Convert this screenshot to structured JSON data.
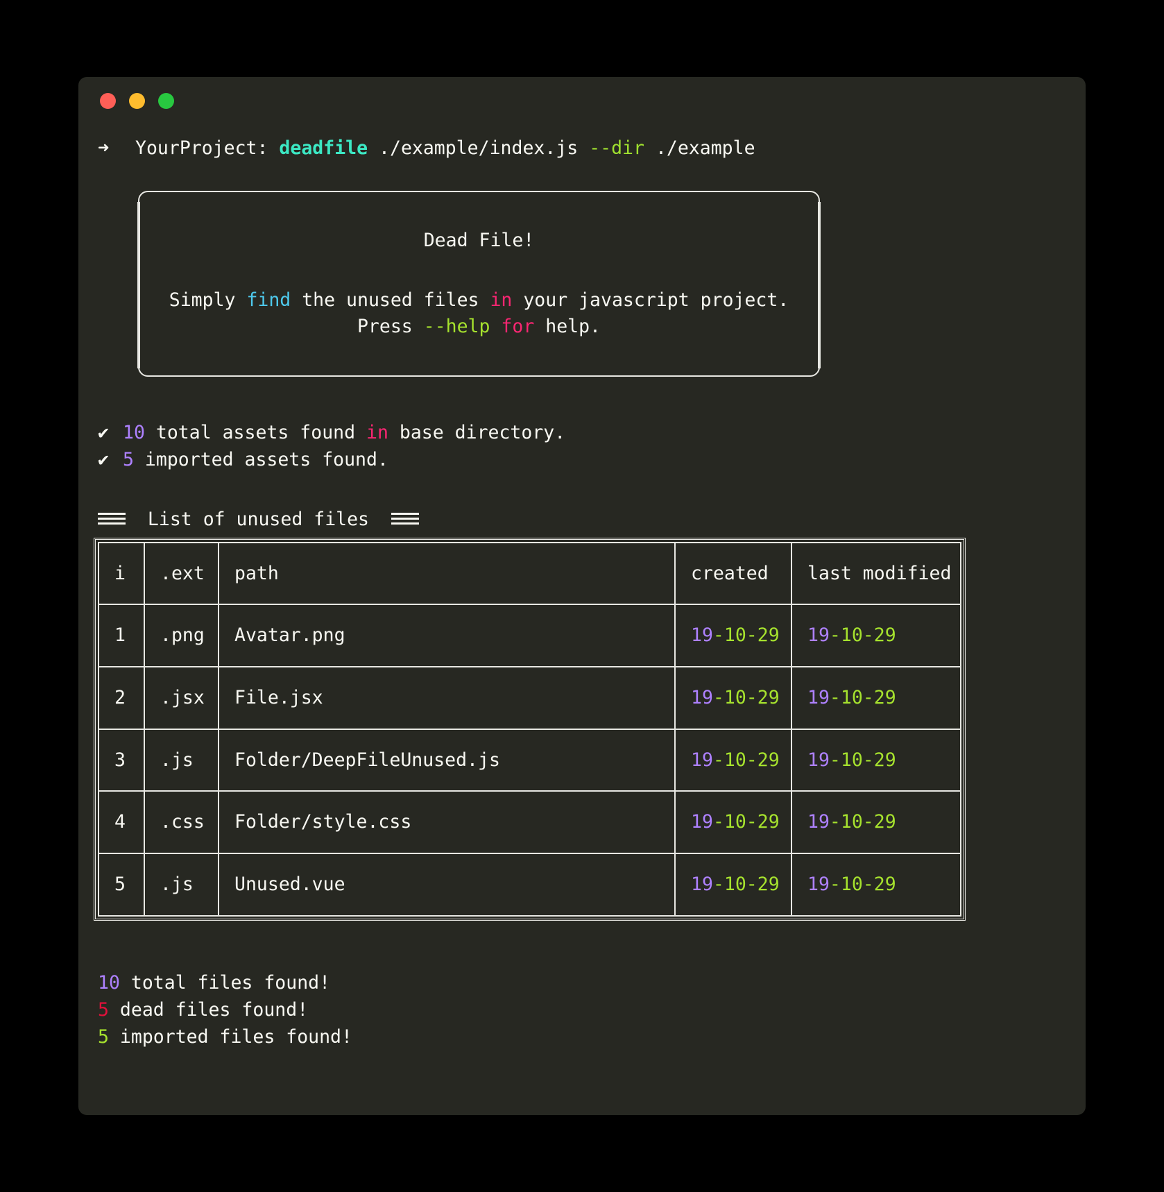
{
  "window": {
    "buttons": [
      {
        "name": "close",
        "color": "#ff5f57"
      },
      {
        "name": "minimize",
        "color": "#febc2e"
      },
      {
        "name": "maximize",
        "color": "#28c840"
      }
    ]
  },
  "prompt": {
    "arrow": "➜",
    "project": "YourProject:",
    "command": "deadfile",
    "arg_entry": "./example/index.js",
    "flag": "--dir",
    "flag_value": "./example"
  },
  "banner": {
    "title": "Dead File!",
    "line1_a": "Simply ",
    "line1_find": "find",
    "line1_b": " the unused files ",
    "line1_in": "in",
    "line1_c": " your javascript project.",
    "line2_a": "Press ",
    "line2_help": "--help",
    "line2_b": " ",
    "line2_for": "for",
    "line2_c": " help."
  },
  "checks": [
    {
      "mark": "✔",
      "count": "10",
      "text_a": " total assets found ",
      "highlight": "in",
      "text_b": " base directory."
    },
    {
      "mark": "✔",
      "count": "5",
      "text_a": " imported assets found.",
      "highlight": "",
      "text_b": ""
    }
  ],
  "section": {
    "title": "List of unused files"
  },
  "table": {
    "headers": [
      "i",
      ".ext",
      "path",
      "created",
      "last modified"
    ],
    "rows": [
      {
        "i": "1",
        "ext": ".png",
        "path": "Avatar.png",
        "created_y": "19",
        "created_md": "-10-29",
        "modified_y": "19",
        "modified_md": "-10-29"
      },
      {
        "i": "2",
        "ext": ".jsx",
        "path": "File.jsx",
        "created_y": "19",
        "created_md": "-10-29",
        "modified_y": "19",
        "modified_md": "-10-29"
      },
      {
        "i": "3",
        "ext": ".js",
        "path": "Folder/DeepFileUnused.js",
        "created_y": "19",
        "created_md": "-10-29",
        "modified_y": "19",
        "modified_md": "-10-29"
      },
      {
        "i": "4",
        "ext": ".css",
        "path": "Folder/style.css",
        "created_y": "19",
        "created_md": "-10-29",
        "modified_y": "19",
        "modified_md": "-10-29"
      },
      {
        "i": "5",
        "ext": ".js",
        "path": "Unused.vue",
        "created_y": "19",
        "created_md": "-10-29",
        "modified_y": "19",
        "modified_md": "-10-29"
      }
    ]
  },
  "summary": [
    {
      "count": "10",
      "label": " total files found!",
      "color": "purple"
    },
    {
      "count": "5",
      "label": " dead files found!",
      "color": "red"
    },
    {
      "count": "5",
      "label": " imported files found!",
      "color": "green"
    }
  ],
  "colors": {
    "background": "#000000",
    "terminal_bg": "#272822",
    "foreground": "#f8f8f2",
    "teal": "#3ce8c4",
    "green": "#a6e22e",
    "cyan": "#4ec9ec",
    "pink": "#f92672",
    "purple": "#ae81ff",
    "red": "#e0113b"
  }
}
